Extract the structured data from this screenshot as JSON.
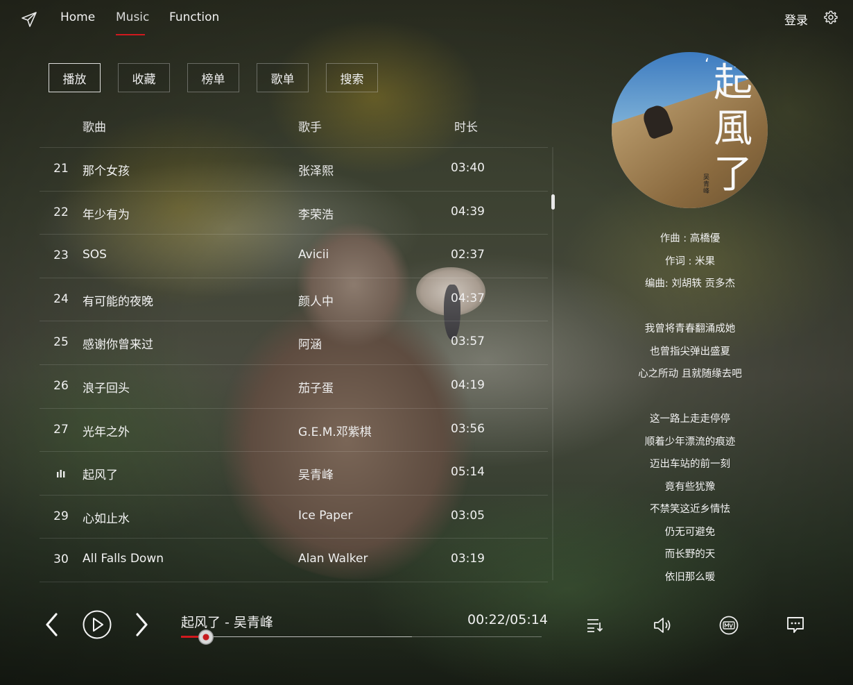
{
  "nav": {
    "items": [
      {
        "label": "Home"
      },
      {
        "label": "Music"
      },
      {
        "label": "Function"
      }
    ],
    "active": "Music",
    "login_label": "登录"
  },
  "subtabs": [
    {
      "label": "播放"
    },
    {
      "label": "收藏"
    },
    {
      "label": "榜单"
    },
    {
      "label": "歌单"
    },
    {
      "label": "搜索"
    }
  ],
  "list": {
    "headers": {
      "song": "歌曲",
      "artist": "歌手",
      "duration": "时长"
    },
    "rows": [
      {
        "num": "21",
        "title": "那个女孩",
        "artist": "张泽熙",
        "duration": "03:40"
      },
      {
        "num": "22",
        "title": "年少有为",
        "artist": "李荣浩",
        "duration": "04:39"
      },
      {
        "num": "23",
        "title": "SOS",
        "artist": "Avicii",
        "duration": "02:37"
      },
      {
        "num": "24",
        "title": "有可能的夜晚",
        "artist": "颜人中",
        "duration": "04:37"
      },
      {
        "num": "25",
        "title": "感谢你曾来过",
        "artist": "阿涵",
        "duration": "03:57"
      },
      {
        "num": "26",
        "title": "浪子回头",
        "artist": "茄子蛋",
        "duration": "04:19"
      },
      {
        "num": "27",
        "title": "光年之外",
        "artist": "G.E.M.邓紫棋",
        "duration": "03:56"
      },
      {
        "num": "",
        "title": "起风了",
        "artist": "吴青峰",
        "duration": "05:14"
      },
      {
        "num": "29",
        "title": "心如止水",
        "artist": "Ice Paper",
        "duration": "03:05"
      },
      {
        "num": "30",
        "title": "All Falls Down",
        "artist": "Alan Walker",
        "duration": "03:19"
      }
    ],
    "playing_row_index": 7
  },
  "cover": {
    "title_chars": [
      "起",
      "風",
      "了"
    ],
    "quote_mark": "‘",
    "artist_vertical": "吴青峰"
  },
  "lyrics": {
    "credits": [
      "作曲 : 高橋優",
      "作词 : 米果",
      "编曲:  刘胡轶 贡多杰"
    ],
    "lines": [
      "我曾将青春翻涌成她",
      "也曾指尖弹出盛夏",
      "心之所动 且就随缘去吧",
      "这一路上走走停停",
      "顺着少年漂流的痕迹",
      "迈出车站的前一刻",
      "竟有些犹豫",
      "不禁笑这近乡情怯",
      "仍无可避免",
      "而长野的天",
      "依旧那么暖"
    ]
  },
  "player": {
    "now_playing": "起风了 - 吴青峰",
    "time_display": "00:22/05:14",
    "progress_fraction": 0.07,
    "buffered_fraction": 0.64,
    "accent_color": "#d0191e"
  },
  "icons": {
    "logo": "paper-plane-icon",
    "settings": "gear-icon",
    "prev": "chevron-left-icon",
    "play": "play-circle-icon",
    "next": "chevron-right-icon",
    "playlist": "playlist-icon",
    "volume": "volume-icon",
    "mv": "mv-icon",
    "comments": "comment-icon"
  }
}
